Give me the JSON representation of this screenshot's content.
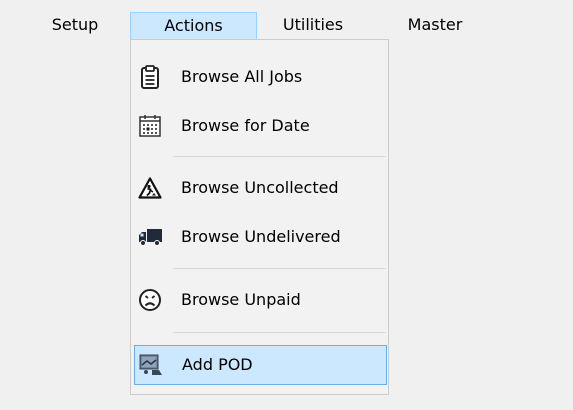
{
  "menubar": {
    "items": [
      {
        "label": "Setup"
      },
      {
        "label": "Actions"
      },
      {
        "label": "Utilities"
      },
      {
        "label": "Master"
      }
    ]
  },
  "actions_menu": {
    "items": [
      {
        "label": "Browse All Jobs",
        "icon": "clipboard-icon"
      },
      {
        "label": "Browse for Date",
        "icon": "calendar-icon"
      },
      {
        "label": "Browse Uncollected",
        "icon": "roadwork-warning-icon"
      },
      {
        "label": "Browse Undelivered",
        "icon": "truck-icon"
      },
      {
        "label": "Browse Unpaid",
        "icon": "sad-face-icon"
      },
      {
        "label": "Add POD",
        "icon": "scan-document-icon"
      }
    ],
    "highlighted": "Add POD"
  },
  "colors": {
    "background": "#f0f0f0",
    "menu_background": "#f2f2f2",
    "highlight_fill": "#cce8ff",
    "highlight_border": "#6aaee8",
    "separator": "#d7d7d7"
  }
}
